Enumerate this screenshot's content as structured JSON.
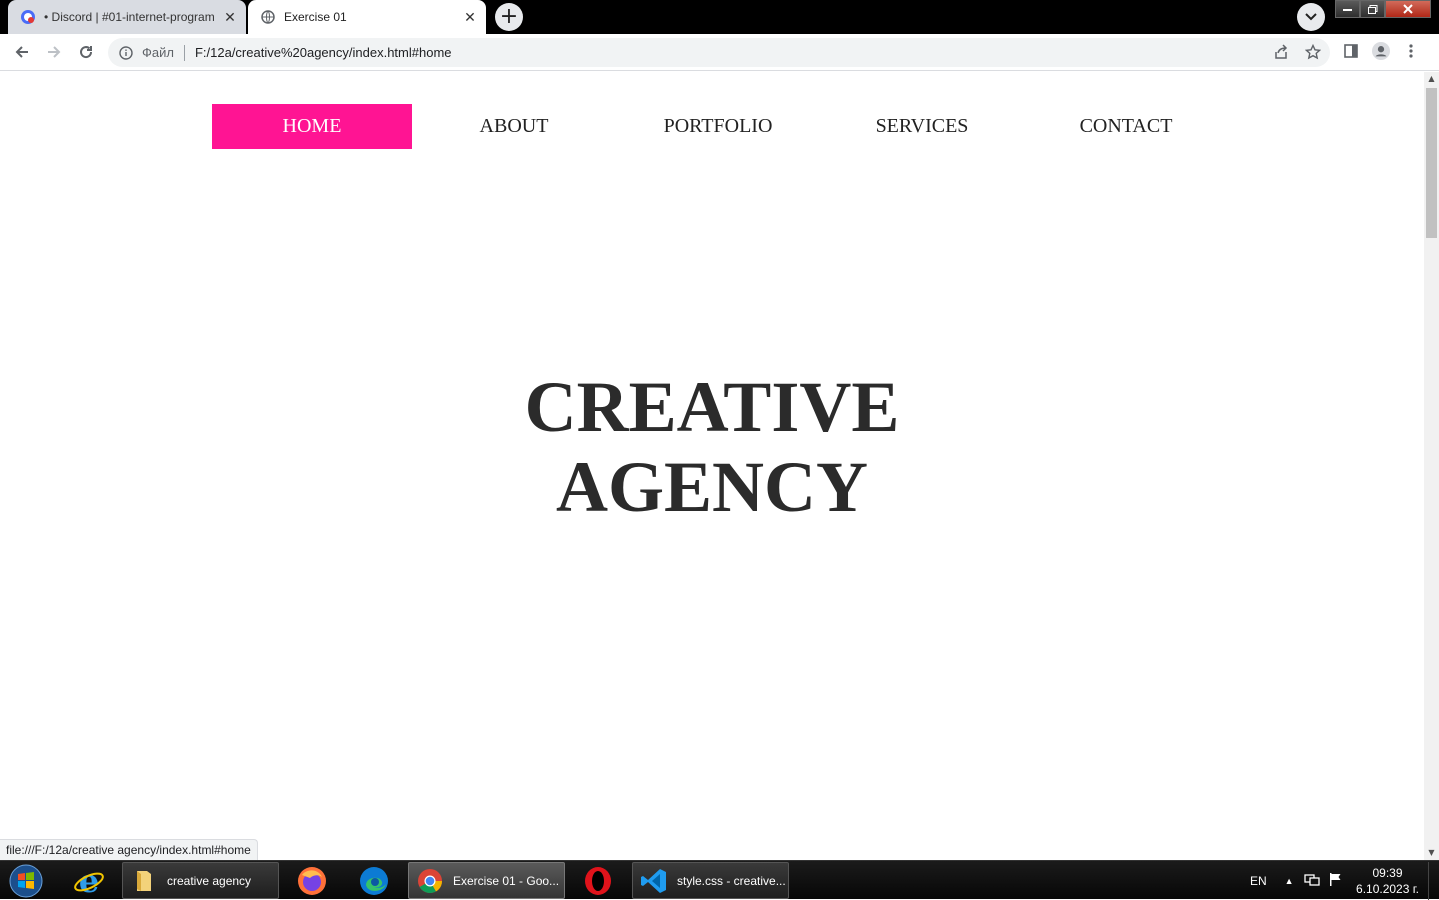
{
  "browser": {
    "tabs": [
      {
        "title": "• Discord | #01-internet-program",
        "active": false
      },
      {
        "title": "Exercise 01",
        "active": true
      }
    ],
    "newtab_label": "+",
    "close_glyph": "✕",
    "address": {
      "scheme_label": "Файл",
      "url": "F:/12a/creative%20agency/index.html#home"
    },
    "status_url": "file:///F:/12a/creative agency/index.html#home"
  },
  "page": {
    "nav": [
      "HOME",
      "ABOUT",
      "PORTFOLIO",
      "SERVICES",
      "CONTACT"
    ],
    "active_nav": "HOME",
    "hero_line1": "CREATIVE",
    "hero_line2": "AGENCY",
    "accent_color": "#ff1493"
  },
  "taskbar": {
    "tasks": [
      {
        "label": "creative agency",
        "icon": "folder-icon"
      },
      {
        "label": "Exercise 01 - Goo...",
        "icon": "chrome-icon"
      },
      {
        "label": "style.css - creative...",
        "icon": "vscode-icon"
      }
    ],
    "pinned": [
      "ie-icon",
      "firefox-icon",
      "edge-icon",
      "opera-icon"
    ],
    "language": "EN",
    "time": "09:39",
    "date": "6.10.2023 г."
  }
}
